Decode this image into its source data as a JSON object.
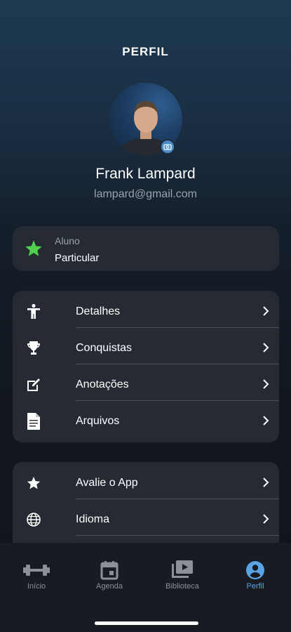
{
  "header": {
    "title": "PERFIL"
  },
  "profile": {
    "name": "Frank Lampard",
    "email": "lampard@gmail.com",
    "avatar_icon": "camera-icon"
  },
  "status": {
    "label": "Aluno",
    "value": "Particular",
    "icon": "star-icon",
    "icon_color": "#4fd14f"
  },
  "menu_group_1": [
    {
      "label": "Detalhes",
      "icon": "person-icon"
    },
    {
      "label": "Conquistas",
      "icon": "trophy-icon"
    },
    {
      "label": "Anotações",
      "icon": "note-icon"
    },
    {
      "label": "Arquivos",
      "icon": "document-icon"
    }
  ],
  "menu_group_2": [
    {
      "label": "Avalie o App",
      "icon": "star-icon"
    },
    {
      "label": "Idioma",
      "icon": "globe-icon"
    }
  ],
  "tabbar": {
    "active_color": "#5aa4e6",
    "items": [
      {
        "label": "Início",
        "icon": "dumbbell-icon",
        "active": false
      },
      {
        "label": "Agenda",
        "icon": "calendar-icon",
        "active": false
      },
      {
        "label": "Biblioteca",
        "icon": "video-library-icon",
        "active": false
      },
      {
        "label": "Perfil",
        "icon": "account-icon",
        "active": true
      }
    ]
  }
}
